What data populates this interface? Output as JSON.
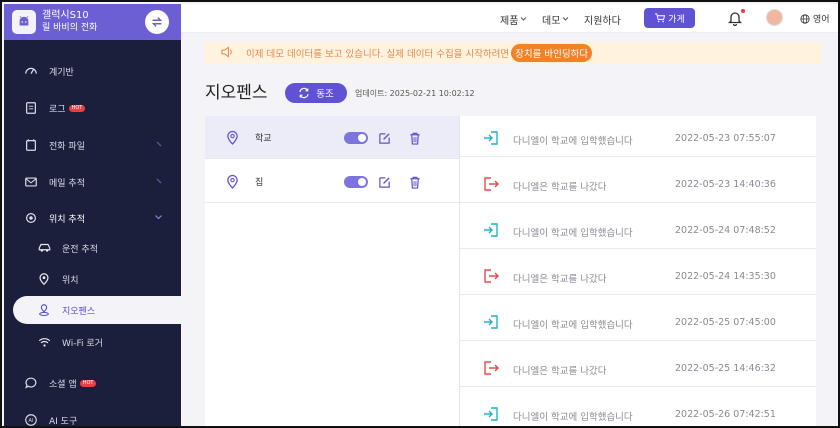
{
  "device": {
    "name": "갤럭시S10",
    "subtitle": "릴 바비의 전화"
  },
  "sidebar": {
    "items": [
      {
        "label": "계기반",
        "icon": "gauge-icon"
      },
      {
        "label": "로그",
        "icon": "log-icon",
        "badge": "HOT"
      },
      {
        "label": "전화 파일",
        "icon": "phone-file-icon"
      },
      {
        "label": "메일 추적",
        "icon": "mail-icon"
      },
      {
        "label": "위치 추적",
        "icon": "location-target-icon"
      },
      {
        "label": "운전 추적",
        "icon": "car-icon"
      },
      {
        "label": "위치",
        "icon": "pin-icon"
      },
      {
        "label": "지오펜스",
        "icon": "geofence-icon"
      },
      {
        "label": "Wi-Fi 로거",
        "icon": "wifi-icon"
      },
      {
        "label": "소셜 앱",
        "icon": "chat-icon",
        "badge": "HOT"
      },
      {
        "label": "AI 도구",
        "icon": "ai-icon"
      }
    ]
  },
  "topbar": {
    "products": "제품",
    "demo": "데모",
    "support": "지원하다",
    "buy": "가게",
    "language": "영어"
  },
  "banner": {
    "text": "이제 데모 데이터를 보고 있습니다. 실제 데이터 수집을 시작하려면",
    "cta": "장치를 바인딩하다"
  },
  "page": {
    "title": "지오펜스",
    "sync": "동조",
    "updated": "업데이트: 2025-02-21 10:02:12"
  },
  "fences": [
    {
      "name": "학교",
      "enabled": true
    },
    {
      "name": "집",
      "enabled": true
    }
  ],
  "events": [
    {
      "type": "enter",
      "text": "다니엘이 학교에 입학했습니다",
      "time": "2022-05-23 07:55:07"
    },
    {
      "type": "exit",
      "text": "다니엘은 학교를 나갔다",
      "time": "2022-05-23 14:40:36"
    },
    {
      "type": "enter",
      "text": "다니엘이 학교에 입학했습니다",
      "time": "2022-05-24 07:48:52"
    },
    {
      "type": "exit",
      "text": "다니엘은 학교를 나갔다",
      "time": "2022-05-24 14:35:30"
    },
    {
      "type": "enter",
      "text": "다니엘이 학교에 입학했습니다",
      "time": "2022-05-25 07:45:00"
    },
    {
      "type": "exit",
      "text": "다니엘은 학교를 나갔다",
      "time": "2022-05-25 14:46:32"
    },
    {
      "type": "enter",
      "text": "다니엘이 학교에 입학했습니다",
      "time": "2022-05-26 07:42:51"
    }
  ],
  "colors": {
    "accent": "#5f52d4",
    "sidebar": "#1b1f3c",
    "enter": "#1fb3c7",
    "exit": "#e84a4a",
    "banner": "#f0822a"
  }
}
